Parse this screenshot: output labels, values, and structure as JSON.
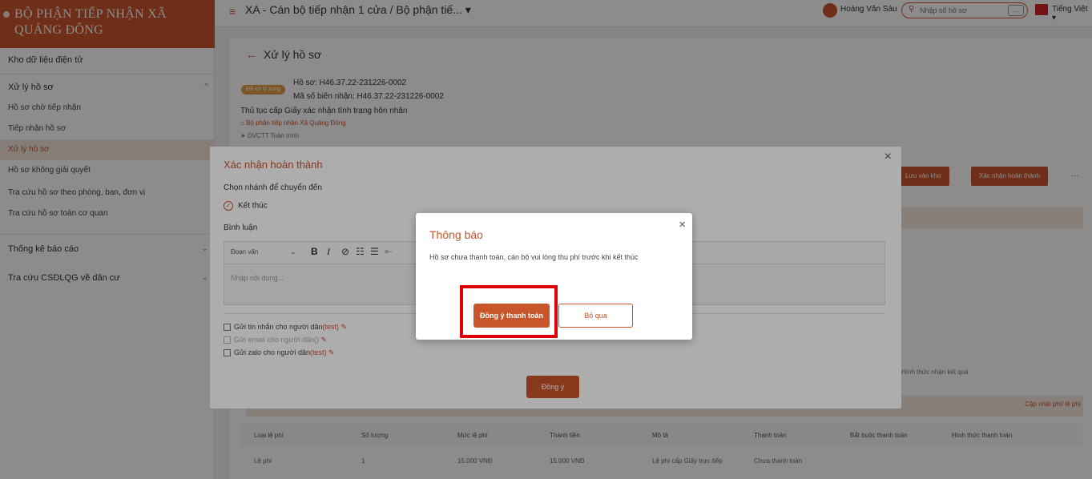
{
  "sidebar": {
    "brand": "BỘ PHẬN TIẾP NHẬN XÃ QUẢNG ĐÔNG",
    "items": [
      {
        "label": "Kho dữ liệu điện tử"
      },
      {
        "label": "Xử lý hồ sơ"
      },
      {
        "label": "Hồ sơ chờ tiếp nhận"
      },
      {
        "label": "Tiếp nhận hồ sơ"
      },
      {
        "label": "Xử lý hồ sơ"
      },
      {
        "label": "Hồ sơ không giải quyết"
      },
      {
        "label": "Tra cứu hồ sơ theo phòng, ban, đơn vị"
      },
      {
        "label": "Tra cứu hồ sơ toàn cơ quan"
      },
      {
        "label": "Thống kê báo cáo"
      },
      {
        "label": "Tra cứu CSDLQG về dân cư"
      }
    ]
  },
  "topbar": {
    "breadcrumb": "XA - Cán bộ tiếp nhận 1 cửa / Bộ phận tiế... ▾",
    "user_name": "Hoàng Văn Sáu",
    "search_placeholder": "Nhập số hồ sơ",
    "search_more": "...",
    "language": "Tiếng Việt ▾"
  },
  "main": {
    "title": "Xử lý hồ sơ",
    "status": "Đã xử lý xong",
    "hs_code": "Hồ sơ: H46.37.22-231226-0002",
    "receipt_code": "Mã số biên nhận: H46.37.22-231226-0002",
    "procedure": "Thủ tục cấp Giấy xác nhận tình trạng hôn nhân",
    "department": "Bộ phận tiếp nhận Xã Quảng Đông",
    "online_service": "DVCTT Toàn trình",
    "btn_store": "Lưu vào kho",
    "btn_confirm": "Xác nhận hoàn thành",
    "btn_more": "···",
    "result_method": "Hình thức nhận kết quả",
    "fee_update": "Cập nhật phí/ lệ phí",
    "fee_table": {
      "headers": [
        "Loại lệ phí",
        "Số lượng",
        "Mức lệ phí",
        "Thành tiền",
        "Mô tả",
        "Thanh toán",
        "Bắt buộc thanh toán",
        "Hình thức thanh toán"
      ],
      "row": [
        "Lệ phí",
        "1",
        "15.000 VNĐ",
        "15.000 VNĐ",
        "Lệ phí cấp Giấy trực tiếp",
        "Chưa thanh toán",
        "",
        ""
      ]
    }
  },
  "dialog": {
    "title": "Xác nhận hoàn thành",
    "branch_label": "Chọn nhánh để chuyển đến",
    "end_option": "Kết thúc",
    "comment_label": "Bình luận",
    "editor_paragraph": "Đoạn văn",
    "editor_placeholder": "Nhập nội dung...",
    "opt_sms": "Gửi tin nhắn cho người dân",
    "opt_sms_tag": "(test)",
    "opt_email": "Gửi email cho người dân()",
    "opt_zalo": "Gửi zalo cho người dân",
    "opt_zalo_tag": "(test)",
    "ok": "Đồng ý"
  },
  "notice": {
    "title": "Thông báo",
    "message": "Hồ sơ chưa thanh toán, cán bộ vui lòng thu phí trước khi kết thúc",
    "pay": "Đồng ý thanh toán",
    "skip": "Bỏ qua"
  }
}
